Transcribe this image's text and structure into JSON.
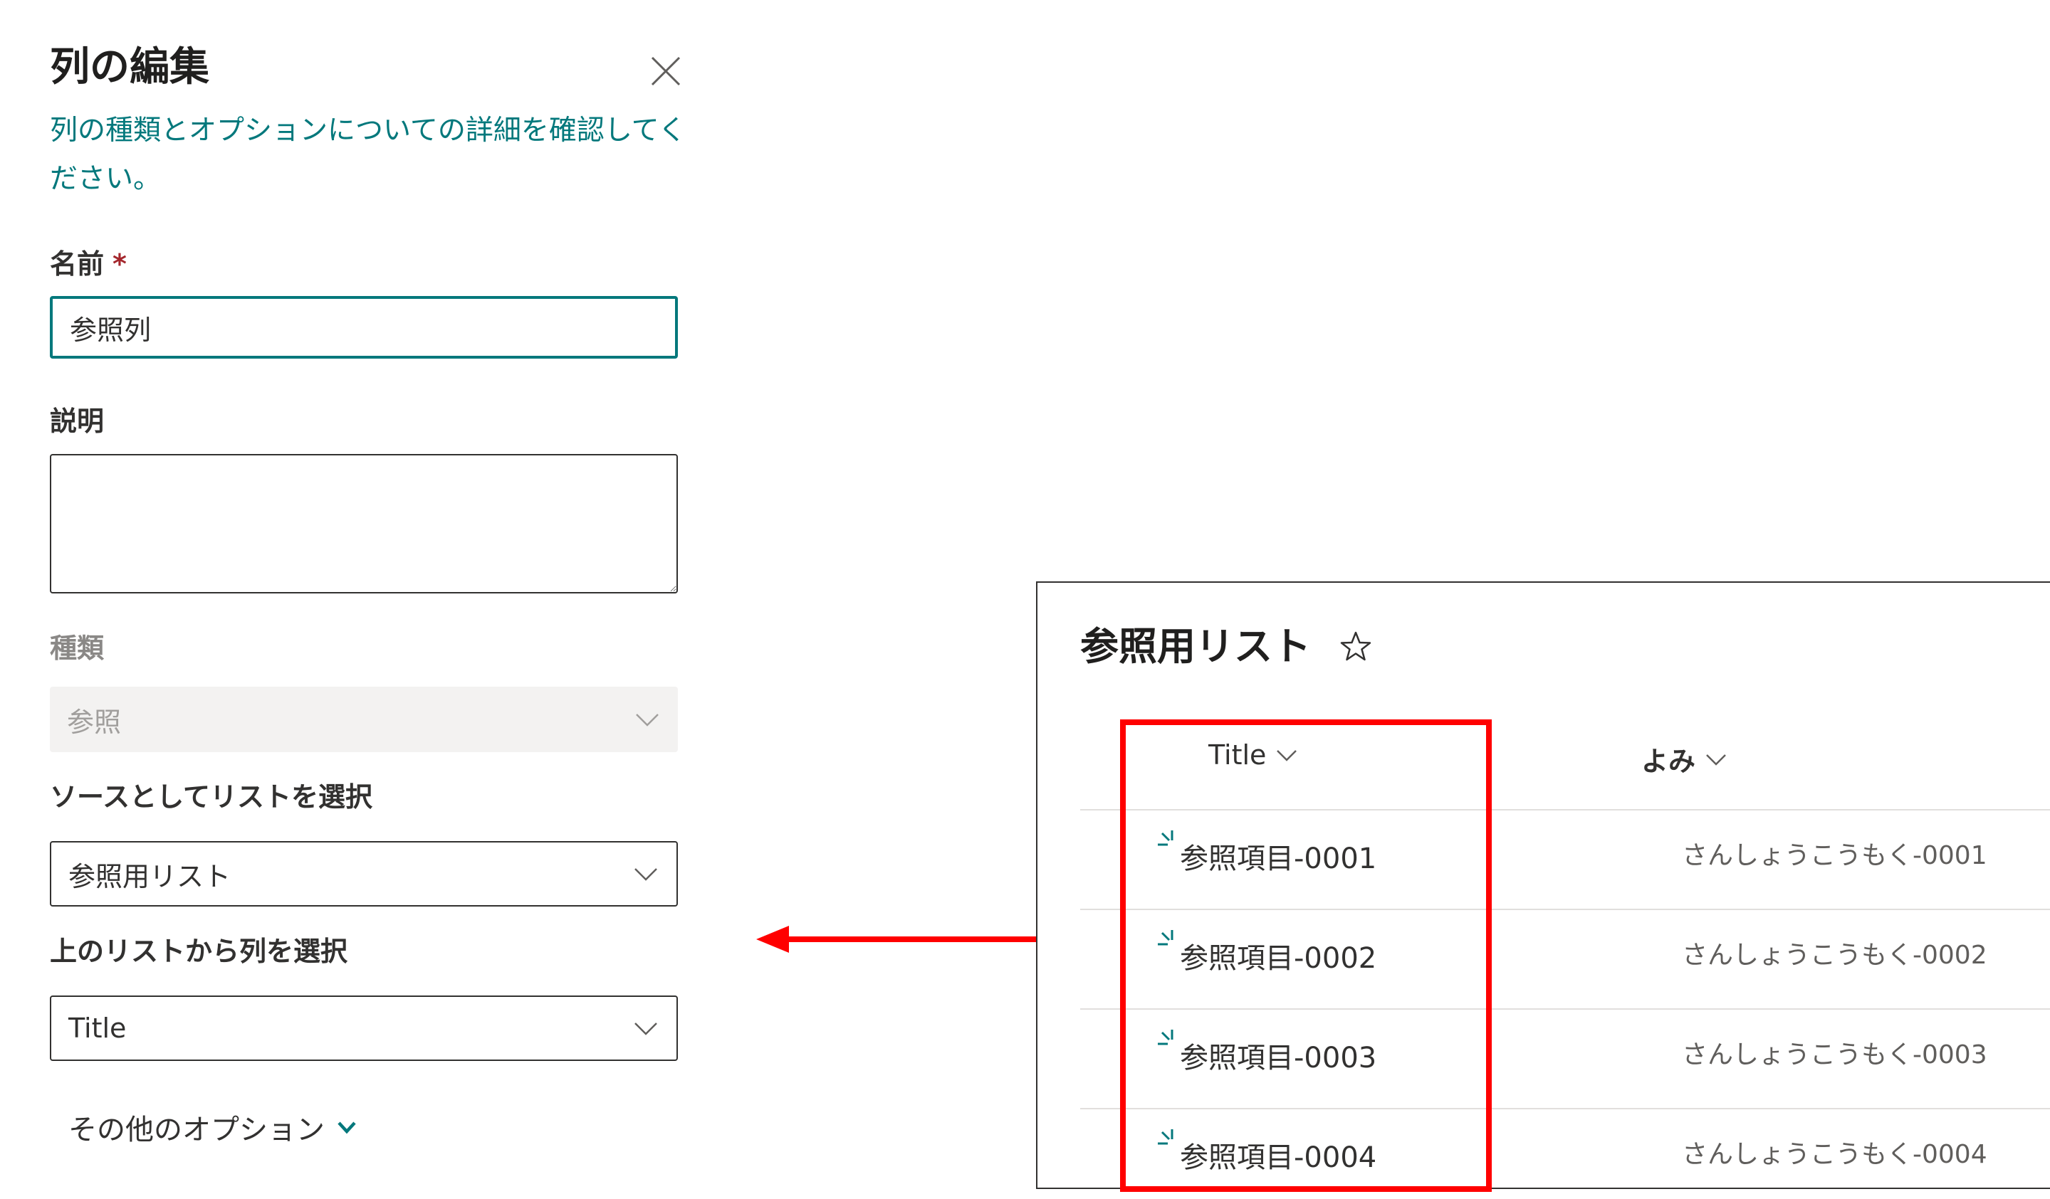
{
  "panel": {
    "title": "列の編集",
    "info_link": "列の種類とオプションについての詳細を確認してください。",
    "name_label": "名前",
    "required_mark": "*",
    "name_value": "参照列",
    "description_label": "説明",
    "description_value": "",
    "type_label": "種類",
    "type_value": "参照",
    "source_list_label": "ソースとしてリストを選択",
    "source_list_value": "参照用リスト",
    "column_label": "上のリストから列を選択",
    "column_value": "Title",
    "more_options": "その他のオプション"
  },
  "list": {
    "title": "参照用リスト",
    "columns": [
      {
        "label": "Title"
      },
      {
        "label": "よみ"
      }
    ],
    "rows": [
      {
        "title": "参照項目-0001",
        "yomi": "さんしょうこうもく-0001"
      },
      {
        "title": "参照項目-0002",
        "yomi": "さんしょうこうもく-0002"
      },
      {
        "title": "参照項目-0003",
        "yomi": "さんしょうこうもく-0003"
      },
      {
        "title": "参照項目-0004",
        "yomi": "さんしょうこうもく-0004"
      }
    ]
  },
  "colors": {
    "accent": "#03787c",
    "highlight": "#ff0000",
    "required": "#a4262c"
  },
  "icons": {
    "close": "close-icon",
    "chevron": "chevron-down-icon",
    "star": "star-outline-icon",
    "new_item": "new-item-icon",
    "arrow": "arrow-left-icon"
  }
}
